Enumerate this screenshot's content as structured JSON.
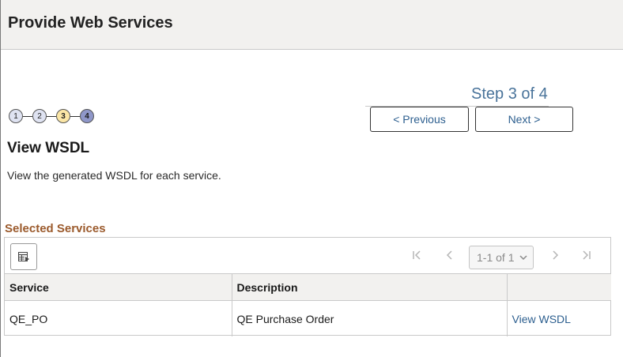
{
  "header": {
    "title": "Provide Web Services"
  },
  "wizard": {
    "step_text": "Step 3 of 4",
    "steps": [
      "1",
      "2",
      "3",
      "4"
    ],
    "current_step": 3,
    "previous_label": "< Previous",
    "next_label": "Next >"
  },
  "section": {
    "title": "View WSDL",
    "description": "View the generated WSDL for each service."
  },
  "grid": {
    "caption": "Selected Services",
    "pagination": "1-1 of 1",
    "columns": [
      "Service",
      "Description",
      ""
    ],
    "rows": [
      {
        "service": "QE_PO",
        "description": "QE Purchase Order",
        "action": "View WSDL"
      }
    ]
  },
  "icons": {
    "personalize": "grid-personalize-icon",
    "first": "first-page-icon",
    "prev": "previous-page-icon",
    "next": "next-page-icon",
    "last": "last-page-icon",
    "dropdown": "chevron-down-icon"
  },
  "colors": {
    "step_text": "#49739a",
    "link": "#2d5f8f",
    "caption": "#9b5a2c",
    "step_current": "#fbe6a6",
    "step_next": "#8f97c9",
    "step_done": "#dfe3f2",
    "header_bg": "#f2f1ef"
  }
}
